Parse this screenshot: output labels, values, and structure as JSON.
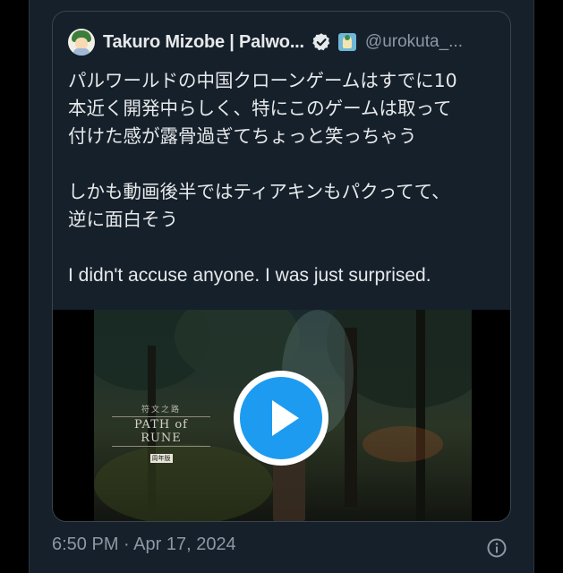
{
  "quoted_tweet": {
    "author_name": "Takuro Mizobe | Palwo...",
    "author_handle": "@urokuta_...",
    "text_line_1": "パルワールドの中国クローンゲームはすでに10\n本近く開発中らしく、特にこのゲームは取って\n付けた感が露骨過ぎてちょっと笑っちゃう",
    "text_line_2": "しかも動画後半ではティアキンもパクってて、\n逆に面白そう",
    "text_line_3": "I didn't accuse anyone. I was just surprised."
  },
  "video": {
    "logo_subtitle": "符文之路",
    "logo_title": "PATH of RUNE",
    "logo_tag": "周年版"
  },
  "tweet_meta": {
    "timestamp": "6:50 PM · Apr 17, 2024"
  },
  "colors": {
    "background": "#15202b",
    "border": "#38444d",
    "text_primary": "#e7e9ea",
    "text_secondary": "#8b98a5",
    "accent": "#1d9bf0"
  },
  "icons": {
    "verified": "verified-badge-icon",
    "play": "play-icon",
    "info": "info-icon"
  }
}
